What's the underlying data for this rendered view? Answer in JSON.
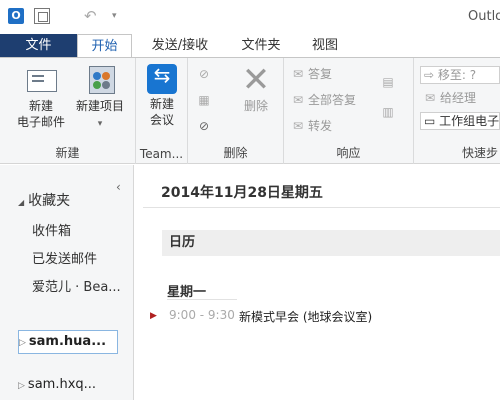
{
  "window": {
    "title": "Outlo"
  },
  "tabs": [
    {
      "label": "文件"
    },
    {
      "label": "开始"
    },
    {
      "label": "发送/接收"
    },
    {
      "label": "文件夹"
    },
    {
      "label": "视图"
    }
  ],
  "ribbon": {
    "new_group": {
      "label": "新建",
      "new_email": "新建\n电子邮件",
      "new_items": "新建项目",
      "new_items_arrow": "▾"
    },
    "team_group": {
      "label": "Team...",
      "new_meeting": "新建\n会议"
    },
    "delete_group": {
      "label": "删除",
      "delete": "删除"
    },
    "respond_group": {
      "label": "响应",
      "reply": "答复",
      "reply_all": "全部答复",
      "forward": "转发"
    },
    "quicksteps_group": {
      "label": "快速步",
      "move_to": "移至: ?",
      "to_manager": "给经理",
      "team_email": "工作组电子"
    }
  },
  "nav": {
    "favorites": "收藏夹",
    "items": [
      {
        "label": "收件箱"
      },
      {
        "label": "已发送邮件"
      },
      {
        "label": "爱范儿 · Bea..."
      }
    ],
    "accounts": [
      {
        "label": "sam.hua..."
      },
      {
        "label": "sam.hxq..."
      }
    ]
  },
  "content": {
    "date_heading": "2014年11月28日星期五",
    "section": "日历",
    "day": "星期一",
    "appointment": {
      "time": "9:00 - 9:30",
      "subject": "新模式早会 (地球会议室)"
    }
  },
  "colors": {
    "file_tab": "#1e3e70",
    "accent": "#1e60b0",
    "appointment_marker": "#b02020"
  }
}
